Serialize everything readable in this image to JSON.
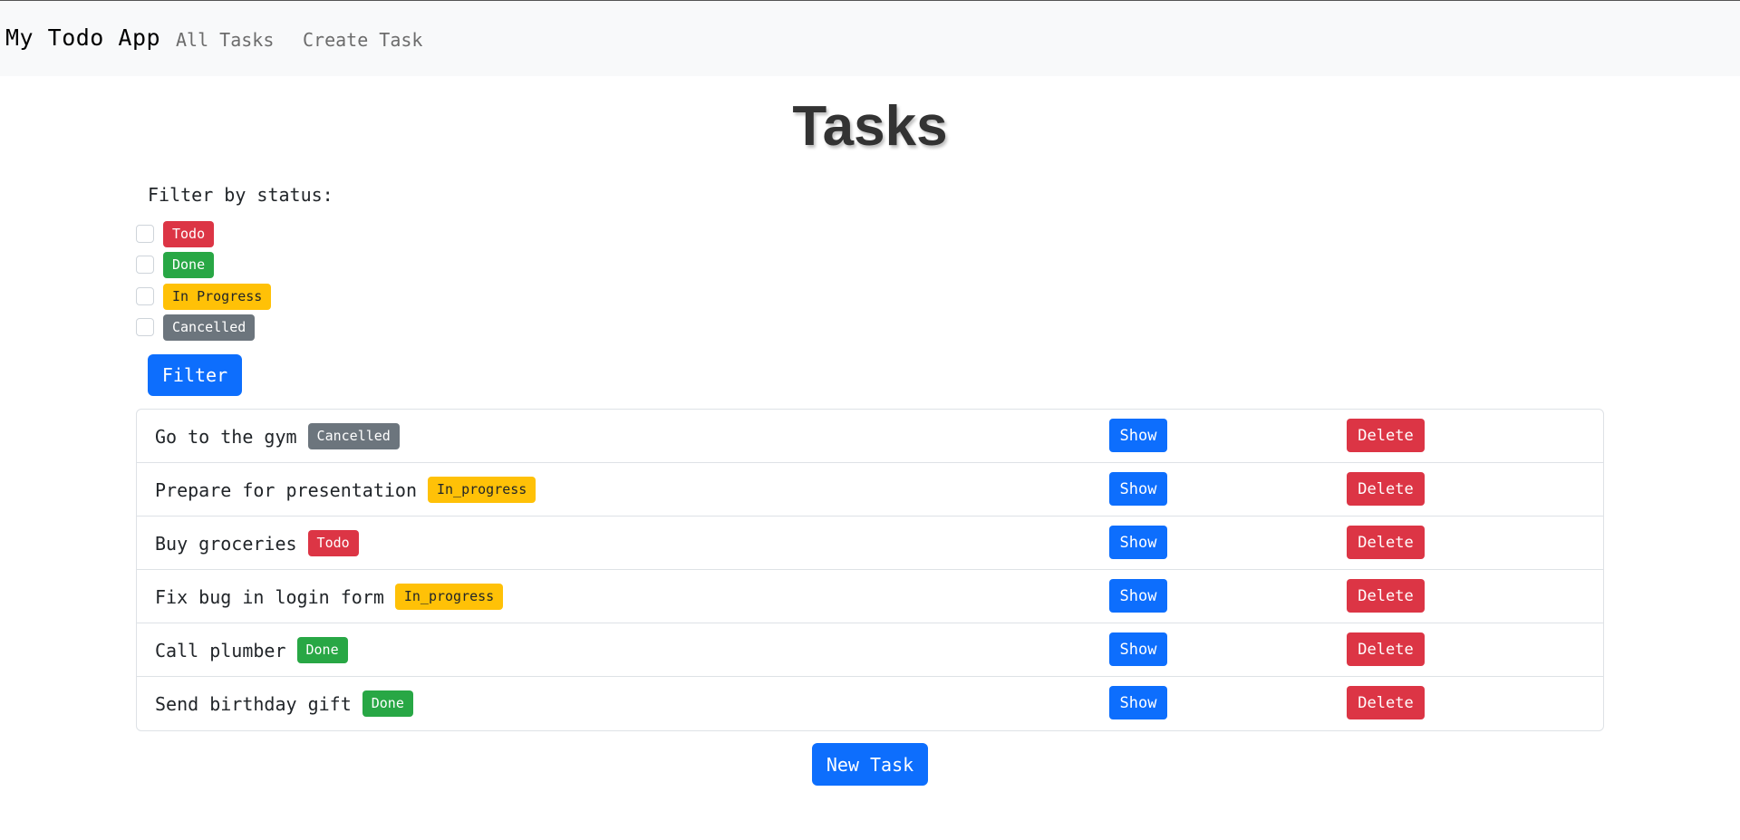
{
  "navbar": {
    "brand": "My Todo App",
    "links": [
      {
        "label": "All Tasks"
      },
      {
        "label": "Create Task"
      }
    ]
  },
  "page": {
    "title": "Tasks"
  },
  "filter": {
    "label": "Filter by status:",
    "options": [
      {
        "label": "Todo",
        "checked": false
      },
      {
        "label": "Done",
        "checked": false
      },
      {
        "label": "In Progress",
        "checked": false
      },
      {
        "label": "Cancelled",
        "checked": false
      }
    ],
    "button_label": "Filter"
  },
  "tasks": [
    {
      "title": "Go to the gym",
      "status": "Cancelled"
    },
    {
      "title": "Prepare for presentation",
      "status": "In_progress"
    },
    {
      "title": "Buy groceries",
      "status": "Todo"
    },
    {
      "title": "Fix bug in login form",
      "status": "In_progress"
    },
    {
      "title": "Call plumber",
      "status": "Done"
    },
    {
      "title": "Send birthday gift",
      "status": "Done"
    }
  ],
  "task_actions": {
    "show_label": "Show",
    "delete_label": "Delete"
  },
  "new_task_label": "New Task",
  "colors": {
    "primary": "#0d6efd",
    "danger": "#dc3545",
    "success": "#28a745",
    "warning": "#ffc107",
    "secondary": "#6c757d"
  }
}
